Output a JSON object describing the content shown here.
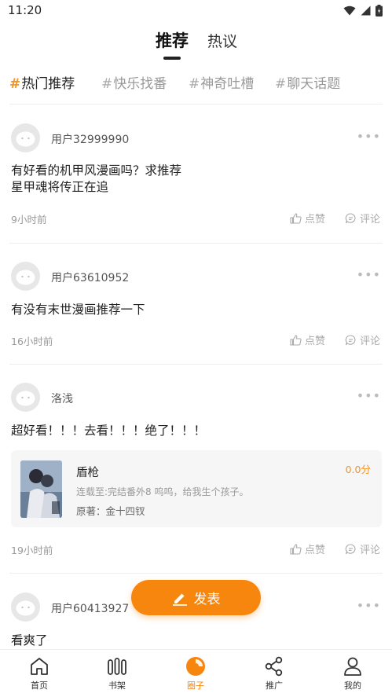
{
  "status_bar": {
    "time": "11:20"
  },
  "top_tabs": [
    {
      "label": "推荐",
      "active": true
    },
    {
      "label": "热议",
      "active": false
    }
  ],
  "topics": [
    {
      "hash": "#",
      "label": "热门推荐",
      "active": true
    },
    {
      "hash": "#",
      "label": "快乐找番",
      "active": false
    },
    {
      "hash": "#",
      "label": "神奇吐槽",
      "active": false
    },
    {
      "hash": "#",
      "label": "聊天话题",
      "active": false
    }
  ],
  "posts": [
    {
      "username": "用户32999990",
      "content_lines": [
        "有好看的机甲风漫画吗？求推荐",
        "星甲魂将传正在追"
      ],
      "time": "9小时前",
      "like_label": "点赞",
      "comment_label": "评论"
    },
    {
      "username": "用户63610952",
      "content_lines": [
        "有没有末世漫画推荐一下"
      ],
      "time": "16小时前",
      "like_label": "点赞",
      "comment_label": "评论"
    },
    {
      "username": "洛浅",
      "content_lines": [
        "超好看！！！去看！！！绝了！！！"
      ],
      "book": {
        "title": "盾枪",
        "score": "0.0分",
        "progress": "连载至:完结番外8 呜呜，给我生个孩子。",
        "author": "原著：金十四钗"
      },
      "time": "19小时前",
      "like_label": "点赞",
      "comment_label": "评论"
    },
    {
      "username": "用户60413927",
      "content_lines": [
        "看爽了"
      ]
    }
  ],
  "fab": {
    "label": "发表"
  },
  "bottom_nav": [
    {
      "label": "首页",
      "icon": "home-icon",
      "active": false
    },
    {
      "label": "书架",
      "icon": "bookshelf-icon",
      "active": false
    },
    {
      "label": "圈子",
      "icon": "circle-icon",
      "active": true
    },
    {
      "label": "推广",
      "icon": "share-icon",
      "active": false
    },
    {
      "label": "我的",
      "icon": "profile-icon",
      "active": false
    }
  ],
  "colors": {
    "accent": "#f7860f",
    "hash_active": "#f7931e",
    "muted": "#999999"
  }
}
